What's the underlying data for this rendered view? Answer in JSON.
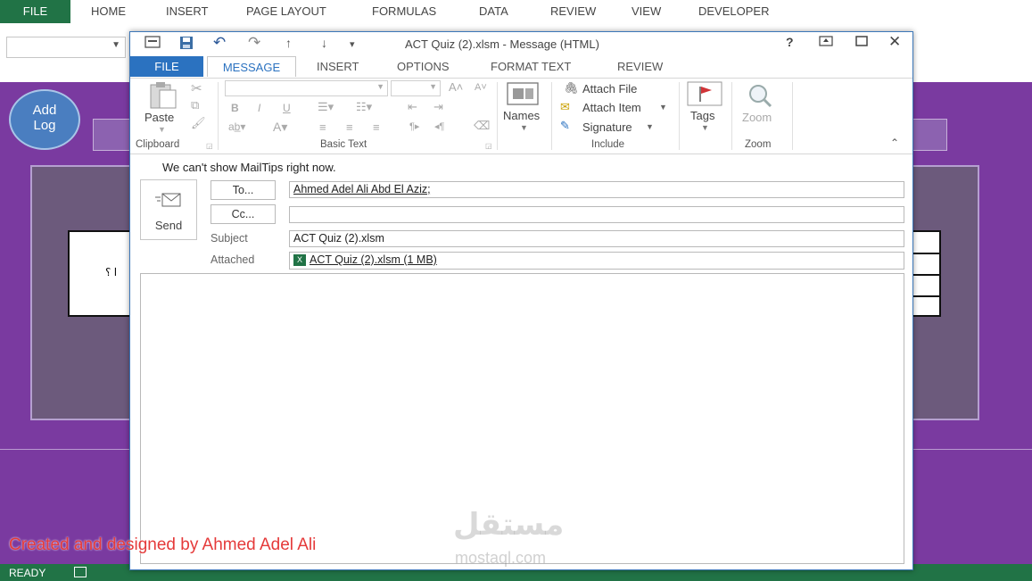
{
  "excel": {
    "tabs": [
      "FILE",
      "HOME",
      "INSERT",
      "PAGE LAYOUT",
      "FORMULAS",
      "DATA",
      "REVIEW",
      "VIEW",
      "DEVELOPER"
    ],
    "add_log_line1": "Add",
    "add_log_line2": "Log",
    "question_text": "ا ؟",
    "status_ready": "READY"
  },
  "outlook": {
    "title": "ACT Quiz (2).xlsm - Message (HTML)",
    "help": "?",
    "tabs": {
      "file": "FILE",
      "message": "MESSAGE",
      "insert": "INSERT",
      "options": "OPTIONS",
      "format_text": "FORMAT TEXT",
      "review": "REVIEW"
    },
    "ribbon": {
      "paste": "Paste",
      "clipboard": "Clipboard",
      "basic_text": "Basic Text",
      "bold": "B",
      "italic": "I",
      "underline": "U",
      "names": "Names",
      "attach_file": "Attach File",
      "attach_item": "Attach Item",
      "signature": "Signature",
      "include": "Include",
      "tags": "Tags",
      "zoom_button": "Zoom",
      "zoom_group": "Zoom"
    },
    "mailtips": "We can't show MailTips right now.",
    "send_label": "Send",
    "to_label": "To...",
    "cc_label": "Cc...",
    "subject_label": "Subject",
    "attached_label": "Attached",
    "to_value": "Ahmed Adel Ali Abd El Aziz;",
    "cc_value": "",
    "subject_value": "ACT Quiz (2).xlsm",
    "attachment_value": "ACT Quiz (2).xlsm (1 MB)"
  },
  "overlay": {
    "credit": "Created and designed by Ahmed Adel Ali",
    "watermark_logo": "مستقل",
    "watermark_url": "mostaql.com"
  },
  "colors": {
    "excel_green": "#217346",
    "sheet_purple": "#7a3aa0",
    "outlook_blue": "#2b72c0"
  }
}
